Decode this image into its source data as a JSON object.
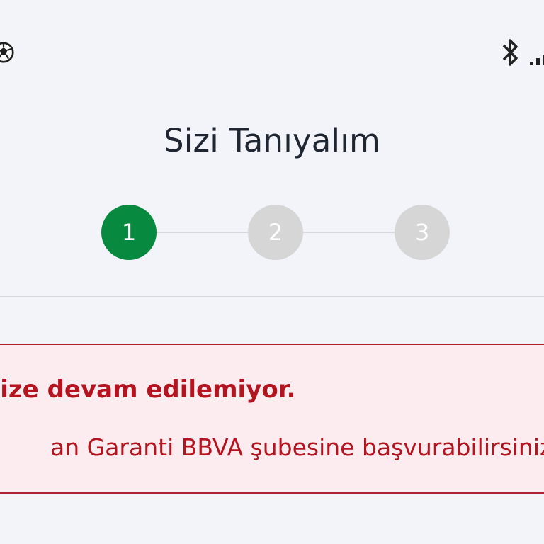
{
  "status_bar": {
    "left_icon": "soccer-ball-icon",
    "right_icons": [
      "bluetooth-icon",
      "signal-icon"
    ]
  },
  "header": {
    "title": "Sizi Tanıyalım"
  },
  "stepper": {
    "steps": [
      {
        "label": "1",
        "state": "active"
      },
      {
        "label": "2",
        "state": "inactive"
      },
      {
        "label": "3",
        "state": "inactive"
      }
    ],
    "active_color": "#07893f",
    "inactive_color": "#d6d6d6"
  },
  "alert": {
    "title": "size devam edilemiyor.",
    "message": "an Garanti BBVA şubesine başvurabilirsiniz.",
    "text_color": "#b3141f",
    "border_color": "#b0222e",
    "background_color": "#fdecef"
  }
}
